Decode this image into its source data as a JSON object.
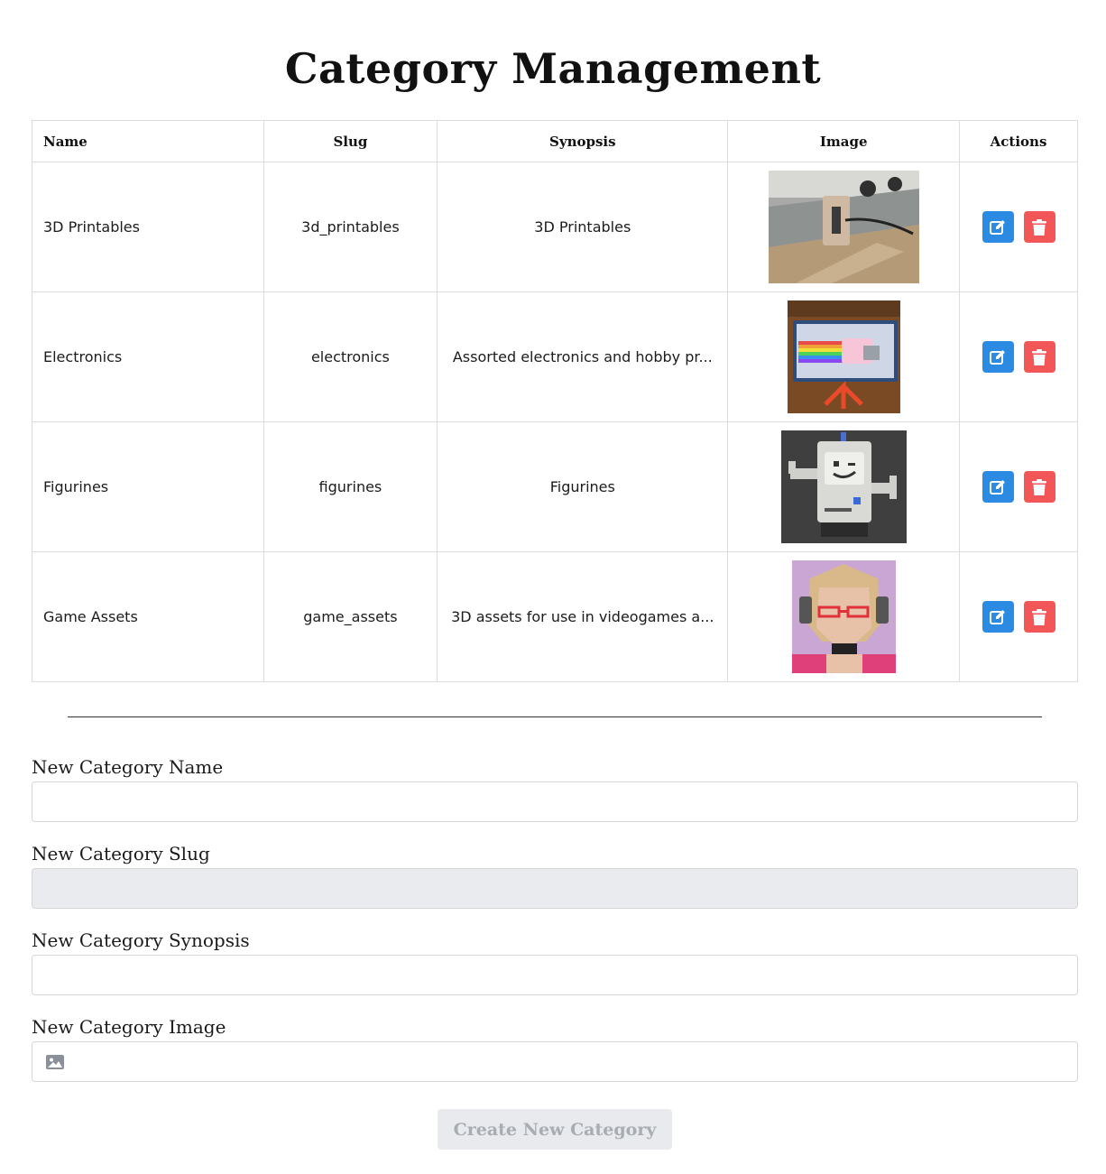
{
  "page": {
    "title": "Category Management"
  },
  "table": {
    "headers": {
      "name": "Name",
      "slug": "Slug",
      "synopsis": "Synopsis",
      "image": "Image",
      "actions": "Actions"
    },
    "rows": [
      {
        "name": "3D Printables",
        "slug": "3d_printables",
        "synopsis": "3D Printables"
      },
      {
        "name": "Electronics",
        "slug": "electronics",
        "synopsis": "Assorted electronics and hobby pr..."
      },
      {
        "name": "Figurines",
        "slug": "figurines",
        "synopsis": "Figurines"
      },
      {
        "name": "Game Assets",
        "slug": "game_assets",
        "synopsis": "3D assets for use in videogames a..."
      }
    ]
  },
  "form": {
    "name_label": "New Category Name",
    "name_value": "",
    "slug_label": "New Category Slug",
    "slug_value": "",
    "synopsis_label": "New Category Synopsis",
    "synopsis_value": "",
    "image_label": "New Category Image",
    "submit_label": "Create New Category"
  },
  "icons": {
    "edit": "edit-icon",
    "delete": "trash-icon",
    "image": "image-icon"
  },
  "colors": {
    "edit_button": "#2b8ae2",
    "delete_button": "#f25656",
    "submit_disabled_bg": "#e8eaed",
    "submit_disabled_text": "#a7adb3"
  }
}
